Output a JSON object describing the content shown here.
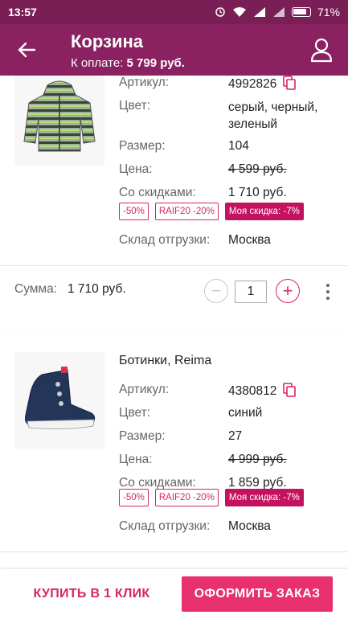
{
  "status_bar": {
    "time": "13:57",
    "battery": "71%"
  },
  "header": {
    "title": "Корзина",
    "to_pay_label": "К оплате:",
    "to_pay_value": "5 799 руб."
  },
  "items": [
    {
      "name": "",
      "article_label": "Артикул:",
      "article": "4992826",
      "color_label": "Цвет:",
      "color_line1": "серый, черный,",
      "color_line2": "зеленый",
      "size_label": "Размер:",
      "size": "104",
      "price_label": "Цена:",
      "price": "4 599 руб.",
      "discount_label": "Со скидками:",
      "discount_price": "1 710 руб.",
      "badges": [
        "-50%",
        "RAIF20 -20%",
        "Моя скидка: -7%"
      ],
      "warehouse_label": "Склад отгрузки:",
      "warehouse": "Москва",
      "sum_label": "Сумма:",
      "sum": "1 710 руб.",
      "quantity": "1"
    },
    {
      "name": "Ботинки, Reima",
      "article_label": "Артикул:",
      "article": "4380812",
      "color_label": "Цвет:",
      "color": "синий",
      "size_label": "Размер:",
      "size": "27",
      "price_label": "Цена:",
      "price": "4 999 руб.",
      "discount_label": "Со скидками:",
      "discount_price": "1 859 руб.",
      "badges": [
        "-50%",
        "RAIF20 -20%",
        "Моя скидка: -7%"
      ],
      "warehouse_label": "Склад отгрузки:",
      "warehouse": "Москва"
    }
  ],
  "bottom": {
    "one_click": "КУПИТЬ В 1 КЛИК",
    "checkout": "ОФОРМИТЬ ЗАКАЗ"
  },
  "colors": {
    "header": "#8a2160",
    "accent": "#e9306f",
    "badge": "#d52567"
  },
  "icons": [
    "back-arrow-icon",
    "user-icon",
    "copy-icon",
    "minus-icon",
    "plus-icon",
    "more-vert-icon",
    "wifi-icon",
    "signal-icon",
    "battery-icon"
  ]
}
